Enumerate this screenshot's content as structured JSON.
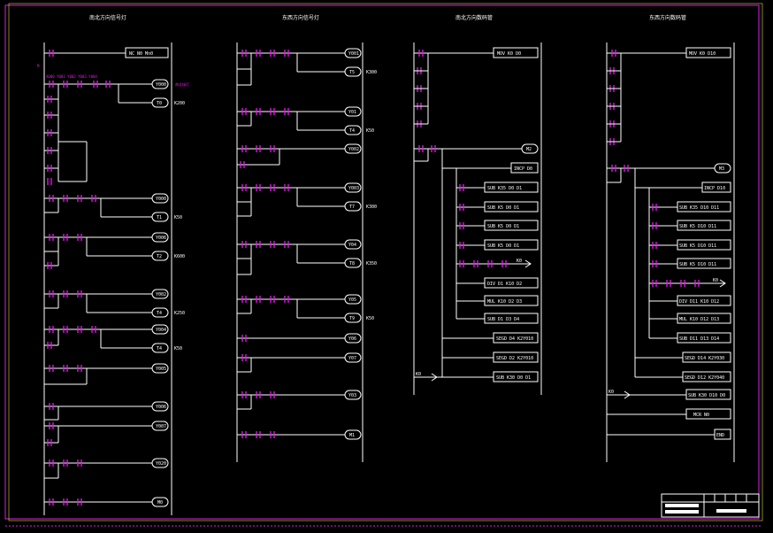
{
  "colors": {
    "background": "#000000",
    "wire": "#ffffff",
    "contact": "#e01ce8",
    "frame_outer": "#e01ce8",
    "frame_inner": "#d9d930"
  },
  "columns": [
    {
      "title": "南北方向信号灯"
    },
    {
      "title": "东西方向信号灯"
    },
    {
      "title": "南北方向数码管"
    },
    {
      "title": "东西方向数码管"
    }
  ],
  "col1": {
    "r1": "NC  N0  Mn0",
    "outs": [
      "Y000",
      "T0",
      "Y000",
      "T1",
      "Y006",
      "T2",
      "Y002",
      "T4",
      "Y004",
      "T4",
      "Y005",
      "Y006",
      "Y007",
      "Y020",
      "M0"
    ],
    "consts": [
      "K200",
      "K50",
      "K600",
      "K250",
      "K50"
    ]
  },
  "col2": {
    "outs": [
      "Y001",
      "T5",
      "Y01",
      "T4",
      "Y002",
      "Y003",
      "T7",
      "Y04",
      "T8",
      "Y05",
      "T9",
      "Y06",
      "Y07",
      "Y03",
      "M1"
    ],
    "consts": [
      "K300",
      "K50",
      "K300",
      "K350",
      "K50"
    ]
  },
  "col3": {
    "r1": "MOV  K0  D0",
    "r2": "M2",
    "instr": [
      "INCP  D0",
      "SUB  K35  D0  D1",
      "SUB  K5  D0  D1",
      "SUB  K5  D0  D1",
      "SUB  K5  D0  D1",
      "K0",
      "DIV  D1  K10  D2",
      "MUL  K10  D2  D3",
      "SUB  D1  D3  D4",
      "SEGD  D4  K2Y010",
      "SEGD  D2  K2Y010",
      "K0",
      "SUB  K30  D0  D1"
    ]
  },
  "col4": {
    "r1": "MOV  K0  D10",
    "r2": "M3",
    "instr": [
      "INCP  D10",
      "SUB  K35  D10  D11",
      "SUB  K5  D10  D11",
      "SUB  K5  D10  D11",
      "SUB  K5  D10  D11",
      "K0",
      "DIV  D11  K10  D12",
      "MUL  K10  D12  D13",
      "SUB  D11  D13  D14",
      "SEGD  D14  K2Y030",
      "SEGD  D12  K2Y040",
      "K0",
      "SUB  K30  D10  D0",
      "MCR  N0",
      "END"
    ]
  }
}
